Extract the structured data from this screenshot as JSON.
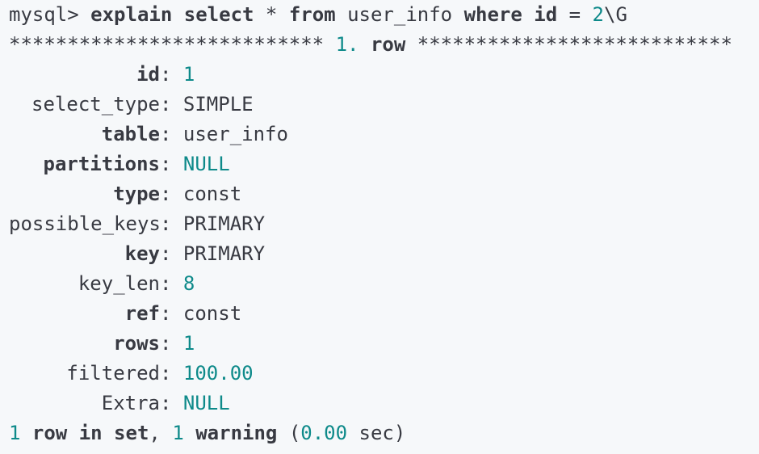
{
  "terminal": {
    "command": {
      "prompt": "mysql>",
      "kw_explain": "explain",
      "kw_select": "select",
      "star": "*",
      "kw_from": "from",
      "table_name": "user_info",
      "kw_where": "where",
      "col_id": "id",
      "eq": "=",
      "value": "2",
      "terminator": "\\G"
    },
    "row_header": {
      "left_stars": "***************************",
      "row_num": "1.",
      "row_word": "row",
      "right_stars": "***************************"
    },
    "rows": [
      {
        "field": "id",
        "bold": true,
        "value": "1",
        "value_kind": "number"
      },
      {
        "field": "select_type",
        "bold": false,
        "value": "SIMPLE",
        "value_kind": "text"
      },
      {
        "field": "table",
        "bold": true,
        "value": "user_info",
        "value_kind": "text"
      },
      {
        "field": "partitions",
        "bold": true,
        "value": "NULL",
        "value_kind": "null"
      },
      {
        "field": "type",
        "bold": true,
        "value": "const",
        "value_kind": "text"
      },
      {
        "field": "possible_keys",
        "bold": false,
        "value": "PRIMARY",
        "value_kind": "text"
      },
      {
        "field": "key",
        "bold": true,
        "value": "PRIMARY",
        "value_kind": "text"
      },
      {
        "field": "key_len",
        "bold": false,
        "value": "8",
        "value_kind": "number"
      },
      {
        "field": "ref",
        "bold": true,
        "value": "const",
        "value_kind": "text"
      },
      {
        "field": "rows",
        "bold": true,
        "value": "1",
        "value_kind": "number"
      },
      {
        "field": "filtered",
        "bold": false,
        "value": "100.00",
        "value_kind": "number"
      },
      {
        "field": "Extra",
        "bold": false,
        "value": "NULL",
        "value_kind": "null"
      }
    ],
    "footer": {
      "count": "1",
      "row_in_set": "row in set",
      "comma": ",",
      "warn_count": "1",
      "warning_word": "warning",
      "open_paren": "(",
      "time": "0.00",
      "sec": "sec)"
    },
    "colors": {
      "background": "#f6f8fa",
      "text": "#383a42",
      "number": "#0e8a8a"
    }
  }
}
